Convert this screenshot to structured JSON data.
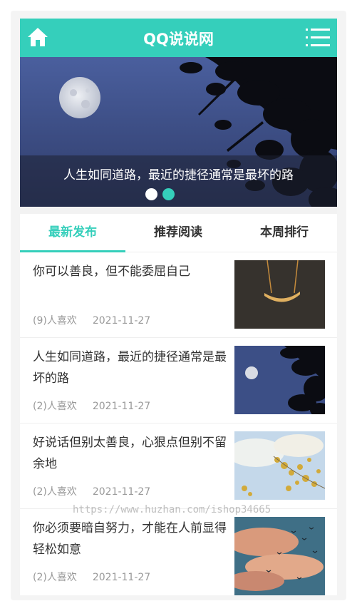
{
  "header": {
    "title": "QQ说说网",
    "home_icon": "home-icon",
    "menu_icon": "menu-icon",
    "color": "#35cfbb"
  },
  "banner": {
    "caption": "人生如同道路，最近的捷径通常是最坏的路",
    "slides_total": 2,
    "active_slide": 2
  },
  "tabs": [
    {
      "label": "最新发布",
      "active": true
    },
    {
      "label": "推荐阅读",
      "active": false
    },
    {
      "label": "本周排行",
      "active": false
    }
  ],
  "posts": [
    {
      "title": "你可以善良，但不能委屈自己",
      "likes": "(9)人喜欢",
      "date": "2021-11-27",
      "thumb": "swing"
    },
    {
      "title": "人生如同道路，最近的捷径通常是最坏的路",
      "likes": "(2)人喜欢",
      "date": "2021-11-27",
      "thumb": "moon"
    },
    {
      "title": "好说话但别太善良，心狠点但别不留余地",
      "likes": "(2)人喜欢",
      "date": "2021-11-27",
      "thumb": "flowers"
    },
    {
      "title": "你必须要暗自努力，才能在人前显得轻松如意",
      "likes": "(2)人喜欢",
      "date": "2021-11-27",
      "thumb": "sunset-birds"
    }
  ],
  "watermark": "https://www.huzhan.com/ishop34665"
}
